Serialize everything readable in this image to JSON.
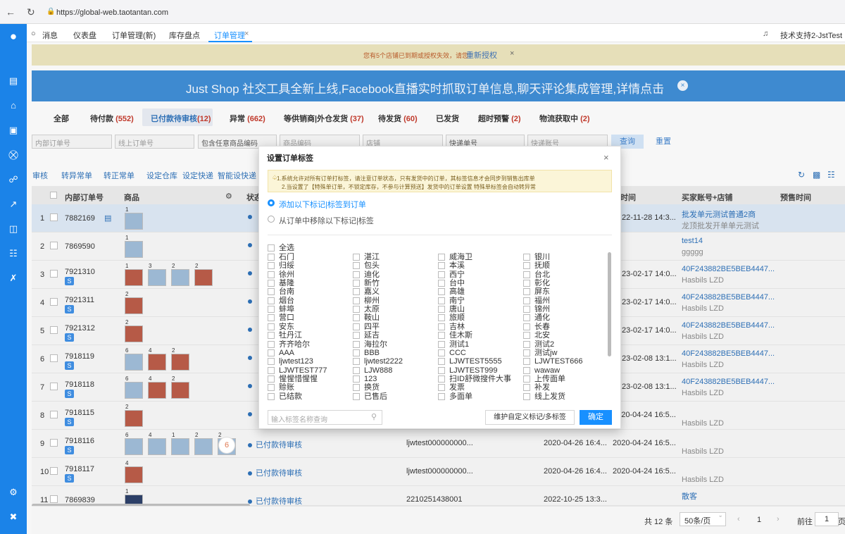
{
  "browser": {
    "url": "https://global-web.taotantan.com"
  },
  "tabs": [
    {
      "label": "消息"
    },
    {
      "label": "仪表盘"
    },
    {
      "label": "订单管理(新)"
    },
    {
      "label": "库存盘点"
    },
    {
      "label": "订单管理",
      "active": true
    }
  ],
  "user": "技术支持2-JstTest",
  "warning": {
    "text": "您有5个店铺已到期或授权失效，请您",
    "link": "重新授权"
  },
  "banner": "Just Shop 社交工具全新上线,Facebook直播实时抓取订单信息,聊天评论集成管理,详情点击",
  "status_tabs": [
    {
      "label": "全部",
      "count": ""
    },
    {
      "label": "待付款",
      "count": "(552)"
    },
    {
      "label": "已付款待审核",
      "count": "(12)",
      "active": true
    },
    {
      "label": "异常",
      "count": "(662)"
    },
    {
      "label": "等供销商|外仓发货",
      "count": "(37)"
    },
    {
      "label": "待发货",
      "count": "(60)"
    },
    {
      "label": "已发货",
      "count": ""
    },
    {
      "label": "超时预警",
      "count": "(2)"
    },
    {
      "label": "物流获取中",
      "count": "(2)"
    }
  ],
  "filters": {
    "internal_order": "内部订单号",
    "online_order": "线上订单号",
    "product_code": "包含任意商品编码",
    "product_code2": "商品编码",
    "store": "店铺",
    "express_no": "快递单号",
    "express_account": "快递账号",
    "query": "查询",
    "reset": "重置"
  },
  "toolbar": [
    "审核",
    "转异常单",
    "转正常单",
    "设定仓库",
    "设定快递",
    "智能设快递"
  ],
  "table": {
    "headers": {
      "internal_order": "内部订单号",
      "product": "商品",
      "status": "状态",
      "time": "款时间",
      "buyer": "买家账号+店铺",
      "presale": "预售时间"
    },
    "rows": [
      {
        "n": "1",
        "id": "7882169",
        "s": false,
        "status": "",
        "online": "",
        "t1": "",
        "t2": "22-11-28 14:3...",
        "buyer": "批发单元测试普通2商",
        "shop": "龙顶批发开单单元测试",
        "sel": true
      },
      {
        "n": "2",
        "id": "7869590",
        "s": false,
        "status": "",
        "online": "",
        "t1": "",
        "t2": "",
        "buyer": "test14",
        "shop": "ggggg",
        "sel": false
      },
      {
        "n": "3",
        "id": "7921310",
        "s": true,
        "status": "",
        "online": "",
        "t1": "",
        "t2": "23-02-17 14:0...",
        "buyer": "40F243882BE5BEB4447...",
        "shop": "Hasbils LZD",
        "sel": false
      },
      {
        "n": "4",
        "id": "7921311",
        "s": true,
        "status": "",
        "online": "",
        "t1": "",
        "t2": "23-02-17 14:0...",
        "buyer": "40F243882BE5BEB4447...",
        "shop": "Hasbils LZD",
        "sel": false
      },
      {
        "n": "5",
        "id": "7921312",
        "s": true,
        "status": "",
        "online": "",
        "t1": "",
        "t2": "23-02-17 14:0...",
        "buyer": "40F243882BE5BEB4447...",
        "shop": "Hasbils LZD",
        "sel": false
      },
      {
        "n": "6",
        "id": "7918119",
        "s": true,
        "status": "",
        "online": "",
        "t1": "",
        "t2": "23-02-08 13:1...",
        "buyer": "40F243882BE5BEB4447...",
        "shop": "Hasbils LZD",
        "sel": false
      },
      {
        "n": "7",
        "id": "7918118",
        "s": true,
        "status": "",
        "online": "",
        "t1": "",
        "t2": "23-02-08 13:1...",
        "buyer": "40F243882BE5BEB4447...",
        "shop": "Hasbils LZD",
        "sel": false
      },
      {
        "n": "8",
        "id": "7918115",
        "s": true,
        "status": "",
        "online": "",
        "t1": "",
        "t2": "2020-04-24 16:5...",
        "buyer": "",
        "shop": "Hasbils LZD",
        "sel": false
      },
      {
        "n": "9",
        "id": "7918116",
        "s": true,
        "status": "已付款待审核",
        "online": "ljwtest000000000...",
        "t1": "2020-04-26 16:4...",
        "t2": "2020-04-24 16:5...",
        "buyer": "",
        "shop": "Hasbils LZD",
        "sel": false
      },
      {
        "n": "10",
        "id": "7918117",
        "s": true,
        "status": "已付款待审核",
        "online": "ljwtest000000000...",
        "t1": "2020-04-26 16:4...",
        "t2": "2020-04-24 16:5...",
        "buyer": "",
        "shop": "Hasbils LZD",
        "sel": false
      },
      {
        "n": "11",
        "id": "7869839",
        "s": false,
        "status": "已付款待审核",
        "online": "2210251438001",
        "t1": "2022-10-25 13:3...",
        "t2": "",
        "buyer": "散客",
        "shop": "",
        "sel": false
      }
    ]
  },
  "footer": {
    "total": "共 12 条",
    "page_size": "50条/页",
    "page": "1",
    "goto_label": "前往",
    "goto_value": "1",
    "page_unit": "页"
  },
  "modal": {
    "title": "设置订单标签",
    "notice1": "1.系统允许对所有订单打标签，请注意订单状态，只有发货中的订单，其标签信息才会同步到销售出库单",
    "notice2": "2.当设置了【特殊单订单，不锁定库存，不参与计算预送】发货中的订单设置 特殊单标签会自动转异常",
    "radio_add": "添加以下标记|标签到订单",
    "radio_remove": "从订单中移除以下标记|标签",
    "select_all": "全选",
    "tags": [
      "石门",
      "湛江",
      "威海卫",
      "银川",
      "归绥",
      "包头",
      "本溪",
      "抚顺",
      "徐州",
      "迪化",
      "西宁",
      "台北",
      "基隆",
      "新竹",
      "台中",
      "彰化",
      "台南",
      "嘉义",
      "高雄",
      "屏东",
      "烟台",
      "柳州",
      "南宁",
      "福州",
      "蚌埠",
      "太原",
      "唐山",
      "锦州",
      "营口",
      "鞍山",
      "旅顺",
      "通化",
      "安东",
      "四平",
      "吉林",
      "长春",
      "牡丹江",
      "延吉",
      "佳木斯",
      "北安",
      "齐齐哈尔",
      "海拉尔",
      "测试1",
      "测试2",
      "AAA",
      "BBB",
      "CCC",
      "测试jw",
      "ljwtest123",
      "ljwtest2222",
      "LJWTEST5555",
      "LJWTEST666",
      "LJWTEST777",
      "LJW888",
      "LJWTEST999",
      "wawaw",
      "惺惺惜惺惺",
      "123",
      "扫ID舒微搜件大事",
      "上传面单",
      "赊账",
      "换货",
      "发票",
      "补发",
      "已结款",
      "已售后",
      "多面单",
      "线上发货"
    ],
    "search_placeholder": "输入标签名称查询",
    "maintain_button": "维护自定义标记/多标签",
    "ok_button": "确定"
  },
  "colors": {
    "sidebar": "#1b83e8",
    "accent": "#1890ff",
    "banner": "#3e8ad0"
  }
}
